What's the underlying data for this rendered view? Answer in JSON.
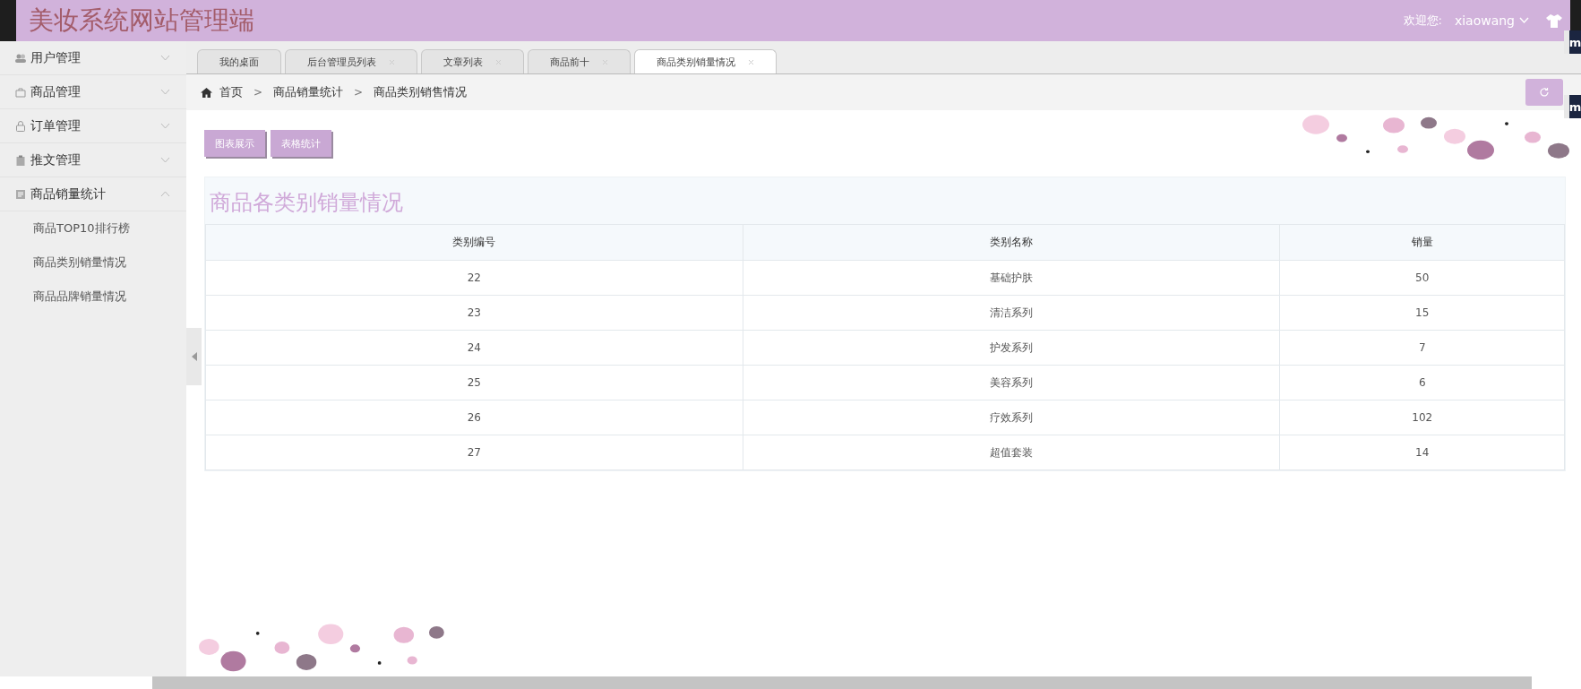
{
  "header": {
    "title": "美妆系统网站管理端",
    "welcome": "欢迎您:",
    "username": "xiaowang"
  },
  "side_widgets": [
    "m",
    "m"
  ],
  "sidebar": {
    "items": [
      {
        "label": "用户管理",
        "expanded": false
      },
      {
        "label": "商品管理",
        "expanded": false
      },
      {
        "label": "订单管理",
        "expanded": false
      },
      {
        "label": "推文管理",
        "expanded": false
      },
      {
        "label": "商品销量统计",
        "expanded": true,
        "children": [
          {
            "label": "商品TOP10排行榜"
          },
          {
            "label": "商品类别销量情况"
          },
          {
            "label": "商品品牌销量情况"
          }
        ]
      }
    ]
  },
  "tabs": [
    {
      "label": "我的桌面",
      "closable": false,
      "selected": false
    },
    {
      "label": "后台管理员列表",
      "closable": true,
      "selected": false
    },
    {
      "label": "文章列表",
      "closable": true,
      "selected": false
    },
    {
      "label": "商品前十",
      "closable": true,
      "selected": false
    },
    {
      "label": "商品类别销量情况",
      "closable": true,
      "selected": true
    }
  ],
  "breadcrumb": [
    {
      "kind": "link",
      "text": "首页"
    },
    {
      "kind": "separator",
      "text": ">"
    },
    {
      "kind": "link",
      "text": "商品销量统计"
    },
    {
      "kind": "separator",
      "text": ">"
    },
    {
      "kind": "link",
      "text": "商品类别销售情况"
    }
  ],
  "buttons": [
    "图表展示",
    "表格统计"
  ],
  "table": {
    "title": "商品各类别销量情况",
    "columns": [
      "类别编号",
      "类别名称",
      "销量"
    ],
    "rows": [
      [
        "22",
        "基础护肤",
        "50"
      ],
      [
        "23",
        "清洁系列",
        "15"
      ],
      [
        "24",
        "护发系列",
        "7"
      ],
      [
        "25",
        "美容系列",
        "6"
      ],
      [
        "26",
        "疗效系列",
        "102"
      ],
      [
        "27",
        "超值套装",
        "14"
      ]
    ]
  }
}
